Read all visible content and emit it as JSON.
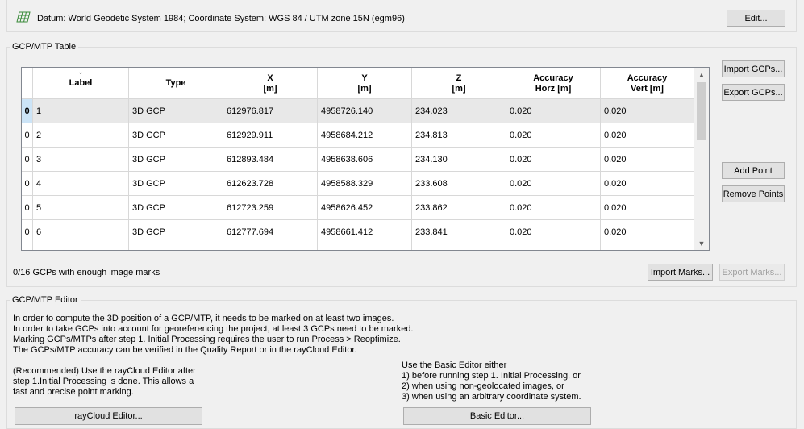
{
  "datum": {
    "icon": "grid-icon",
    "text": "Datum: World Geodetic System 1984; Coordinate System: WGS 84 / UTM zone 15N (egm96)",
    "edit_label": "Edit..."
  },
  "gcp_table": {
    "title": "GCP/MTP Table",
    "columns": [
      {
        "line1": "Label",
        "line2": ""
      },
      {
        "line1": "Type",
        "line2": ""
      },
      {
        "line1": "X",
        "line2": "[m]"
      },
      {
        "line1": "Y",
        "line2": "[m]"
      },
      {
        "line1": "Z",
        "line2": "[m]"
      },
      {
        "line1": "Accuracy",
        "line2": "Horz [m]"
      },
      {
        "line1": "Accuracy",
        "line2": "Vert [m]"
      }
    ],
    "rows": [
      {
        "marks": "0",
        "label": "1",
        "type": "3D GCP",
        "x": "612976.817",
        "y": "4958726.140",
        "z": "234.023",
        "horz": "0.020",
        "vert": "0.020"
      },
      {
        "marks": "0",
        "label": "2",
        "type": "3D GCP",
        "x": "612929.911",
        "y": "4958684.212",
        "z": "234.813",
        "horz": "0.020",
        "vert": "0.020"
      },
      {
        "marks": "0",
        "label": "3",
        "type": "3D GCP",
        "x": "612893.484",
        "y": "4958638.606",
        "z": "234.130",
        "horz": "0.020",
        "vert": "0.020"
      },
      {
        "marks": "0",
        "label": "4",
        "type": "3D GCP",
        "x": "612623.728",
        "y": "4958588.329",
        "z": "233.608",
        "horz": "0.020",
        "vert": "0.020"
      },
      {
        "marks": "0",
        "label": "5",
        "type": "3D GCP",
        "x": "612723.259",
        "y": "4958626.452",
        "z": "233.862",
        "horz": "0.020",
        "vert": "0.020"
      },
      {
        "marks": "0",
        "label": "6",
        "type": "3D GCP",
        "x": "612777.694",
        "y": "4958661.412",
        "z": "233.841",
        "horz": "0.020",
        "vert": "0.020"
      }
    ],
    "buttons": {
      "import_gcps": "Import GCPs...",
      "export_gcps": "Export GCPs...",
      "add_point": "Add Point",
      "remove_points": "Remove Points"
    },
    "status": "0/16 GCPs with enough image marks",
    "import_marks": "Import Marks...",
    "export_marks": "Export Marks..."
  },
  "editor": {
    "title": "GCP/MTP Editor",
    "info_lines": [
      "In order to compute the 3D position of a GCP/MTP, it needs to be marked on at least two images.",
      "In order to take GCPs into account for georeferencing the project, at least 3 GCPs need to be marked.",
      "Marking GCPs/MTPs after step 1. Initial Processing requires the user to run Process > Reoptimize.",
      "The GCPs/MTP accuracy can be verified in the Quality Report or in the rayCloud Editor."
    ],
    "raycloud_lines": [
      "(Recommended) Use the rayCloud Editor after",
      "step 1.Initial Processing is done. This allows a",
      "fast and precise point marking."
    ],
    "basic_lines": [
      "Use the Basic Editor either",
      "1) before running step 1. Initial Processing, or",
      "2) when using non-geolocated images, or",
      "3) when using an arbitrary coordinate system."
    ],
    "raycloud_button": "rayCloud Editor...",
    "basic_button": "Basic Editor..."
  }
}
